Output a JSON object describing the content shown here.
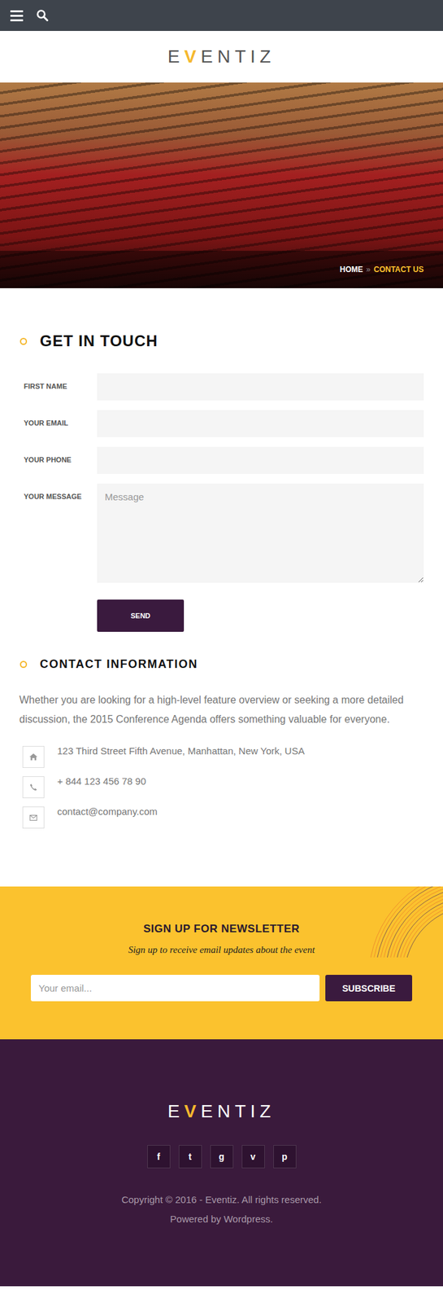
{
  "logo": {
    "prefix": "E",
    "accent": "V",
    "suffix": "ENTIZ"
  },
  "breadcrumb": {
    "separator": "»",
    "items": [
      {
        "label": "HOME",
        "selected": false
      },
      {
        "label": "CONTACT US",
        "selected": true
      }
    ]
  },
  "form": {
    "title": "GET IN TOUCH",
    "fields": [
      {
        "label": "FIRST NAME",
        "kind": "input",
        "placeholder": ""
      },
      {
        "label": "YOUR EMAIL",
        "kind": "input",
        "placeholder": ""
      },
      {
        "label": "YOUR PHONE",
        "kind": "input",
        "placeholder": ""
      },
      {
        "label": "YOUR MESSAGE",
        "kind": "textarea",
        "placeholder": "Message"
      }
    ],
    "submit": "SEND"
  },
  "contact": {
    "title": "CONTACT INFORMATION",
    "intro": "Whether you are looking for a high-level feature overview or seeking a more detailed discussion, the 2015 Conference Agenda offers something valuable for everyone.",
    "items": [
      {
        "kind": "address",
        "text": "123 Third Street Fifth Avenue, Manhattan, New York, USA"
      },
      {
        "kind": "phone",
        "text": "+ 844 123 456 78 90"
      },
      {
        "kind": "email",
        "text": "contact@company.com"
      }
    ]
  },
  "newsletter": {
    "title": "SIGN UP FOR NEWSLETTER",
    "subtitle": "Sign up to receive email updates about the event",
    "placeholder": "Your email...",
    "button": "SUBSCRIBE"
  },
  "footer": {
    "logo": {
      "prefix": "E",
      "accent": "V",
      "suffix": "ENTIZ"
    },
    "social": [
      "f",
      "t",
      "g",
      "v",
      "p"
    ],
    "copyright": "Copyright © 2016 - Eventiz. All rights reserved.",
    "powered": "Powered by Wordpress."
  }
}
